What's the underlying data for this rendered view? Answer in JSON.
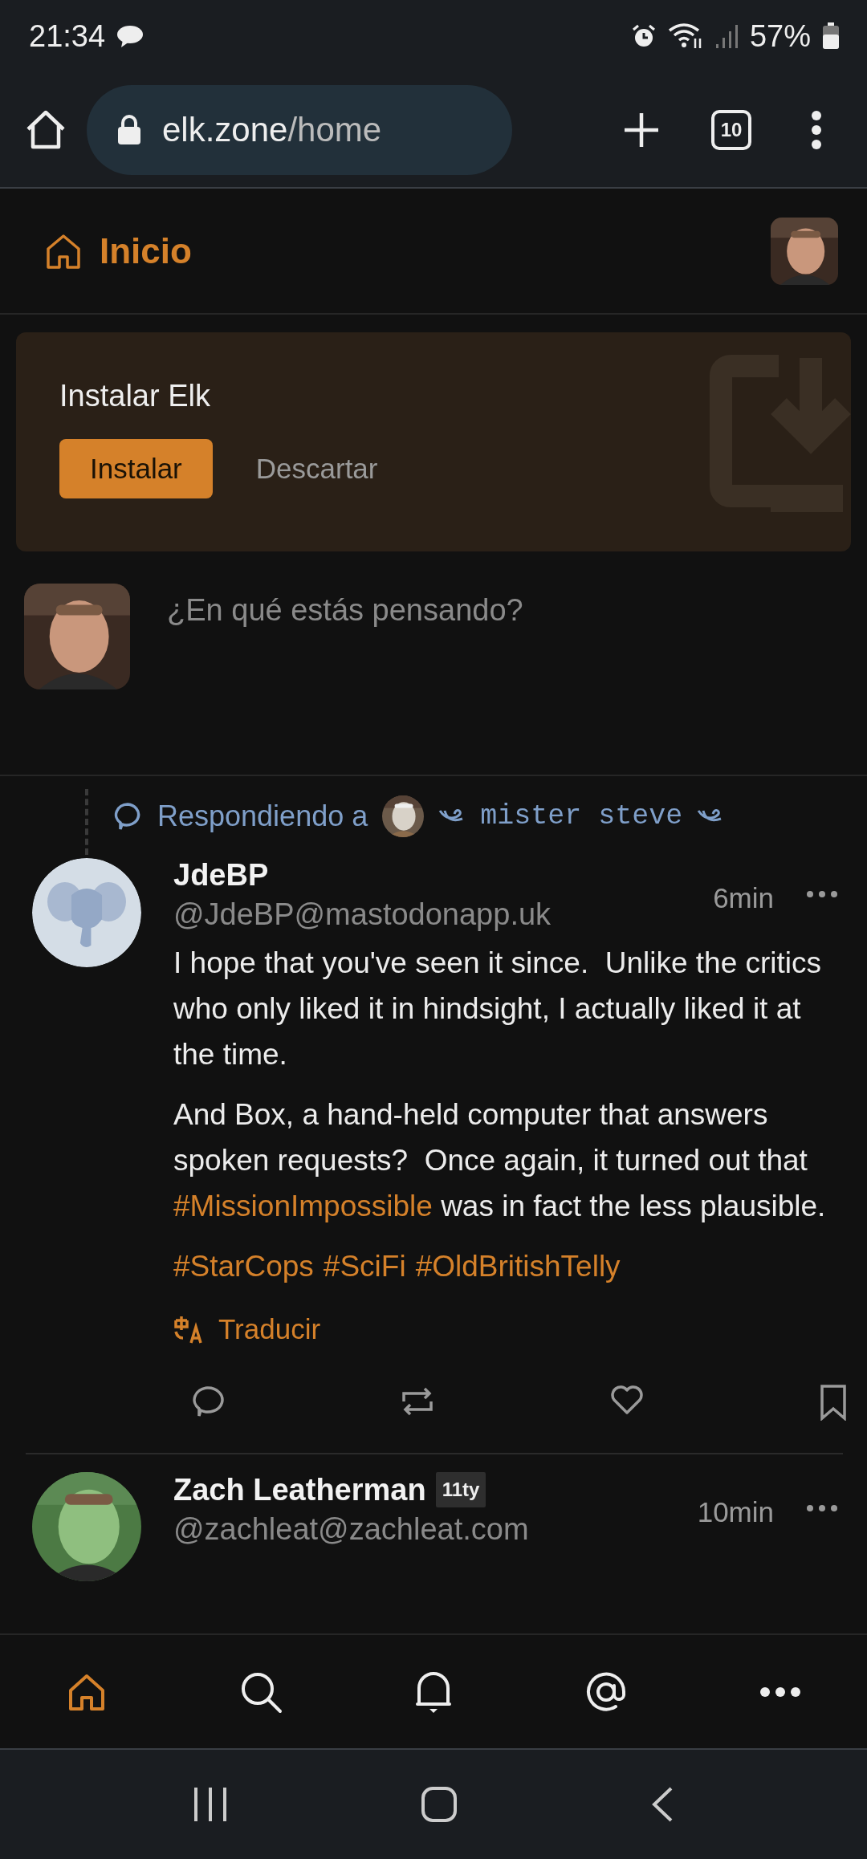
{
  "status_bar": {
    "time": "21:34",
    "battery": "57%"
  },
  "browser": {
    "url_host": "elk.zone",
    "url_path": "/home",
    "tab_count": "10"
  },
  "header": {
    "title": "Inicio"
  },
  "install_banner": {
    "title": "Instalar Elk",
    "buttons": [
      {
        "label": "Instalar",
        "kind": "primary"
      },
      {
        "label": "Descartar",
        "kind": "secondary"
      }
    ]
  },
  "composer": {
    "placeholder": "¿En qué estás pensando?"
  },
  "posts": [
    {
      "reply_to": {
        "label": "Respondiendo a",
        "name": "mister steve"
      },
      "name": "JdeBP",
      "handle": "@JdeBP@mastodonapp.uk",
      "time": "6min",
      "paragraphs": [
        [
          {
            "kind": "text",
            "text": "I hope that you've seen it since.  Unlike the critics who only liked it in hindsight, I actually liked it at the time."
          }
        ],
        [
          {
            "kind": "text",
            "text": "And Box, a hand-held computer that answers spoken requests?  Once again, it turned out that "
          },
          {
            "kind": "hashtag",
            "text": "#MissionImpossible"
          },
          {
            "kind": "text",
            "text": " was in fact the less plausible."
          }
        ]
      ],
      "hashtags": [
        "#StarCops",
        "#SciFi",
        "#OldBritishTelly"
      ],
      "translate": "Traducir"
    },
    {
      "name": "Zach Leatherman",
      "badge": "11ty",
      "handle": "@zachleat@zachleat.com",
      "time": "10min"
    }
  ],
  "bottom_nav": [
    {
      "kind": "home",
      "selected": true
    },
    {
      "kind": "search",
      "selected": false
    },
    {
      "kind": "notifications",
      "selected": false
    },
    {
      "kind": "mentions",
      "selected": false
    },
    {
      "kind": "more",
      "selected": false
    }
  ]
}
